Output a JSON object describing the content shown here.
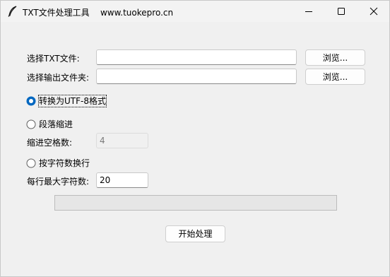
{
  "window": {
    "title": "TXT文件处理工具",
    "subtitle": "www.tuokepro.cn"
  },
  "form": {
    "select_file_label": "选择TXT文件:",
    "select_file_value": "",
    "browse_file_label": "浏览...",
    "output_folder_label": "选择输出文件夹:",
    "output_folder_value": "",
    "browse_folder_label": "浏览..."
  },
  "options": {
    "utf8_label": "转换为UTF-8格式",
    "utf8_selected": true,
    "indent_label": "段落缩进",
    "indent_selected": false,
    "indent_spaces_label": "缩进空格数:",
    "indent_spaces_value": "4",
    "wrap_label": "按字符数换行",
    "wrap_selected": false,
    "max_chars_label": "每行最大字符数:",
    "max_chars_value": "20"
  },
  "progress": {
    "value": 0
  },
  "actions": {
    "start_label": "开始处理"
  },
  "colors": {
    "accent": "#0067c0",
    "window_bg": "#f0f0f0",
    "progress_fill": "#06b025"
  },
  "icons": {
    "app": "feather-icon",
    "minimize": "minimize-icon",
    "maximize": "maximize-icon",
    "close": "close-icon"
  }
}
